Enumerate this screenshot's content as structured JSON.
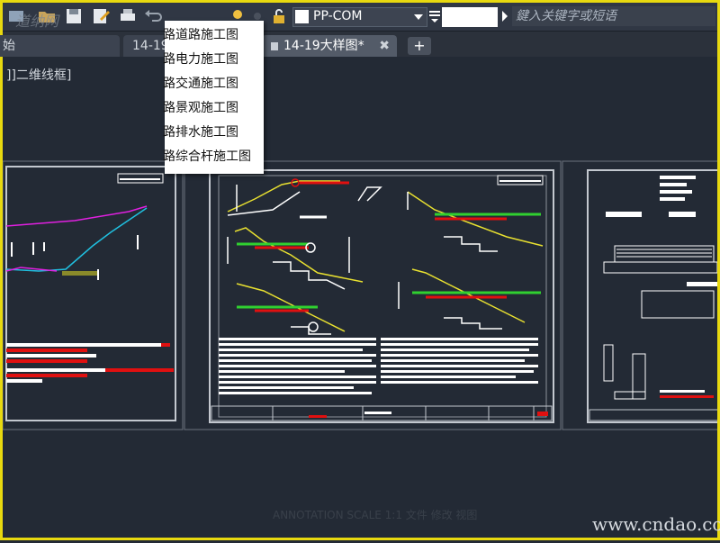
{
  "toolbar": {
    "layer_name": "PP-COM",
    "search_placeholder": "鍵入关键字或短语"
  },
  "tabs": [
    {
      "label": "始"
    },
    {
      "label": "14-19"
    },
    {
      "label": "14-19大样图*"
    }
  ],
  "new_tab_label": "+",
  "viewport_label": "]]二维线框]",
  "dropdown_menu": {
    "items": [
      "路道路施工图",
      "路电力施工图",
      "路交通施工图",
      "路景观施工图",
      "路排水施工图",
      "路综合杆施工图"
    ]
  },
  "watermark_top": "道纳网",
  "watermark_bottom": "www.cndao.com",
  "status_text": "ANNOTATION SCALE 1:1  文件  修改  视图",
  "colors": {
    "background": "#232a35",
    "frame": "#e8d90f",
    "drawing_white": "#ffffff",
    "drawing_red": "#e01010",
    "drawing_yellow": "#e8e030",
    "drawing_green": "#30d030",
    "drawing_magenta": "#e020e0",
    "drawing_cyan": "#20c0e0"
  }
}
